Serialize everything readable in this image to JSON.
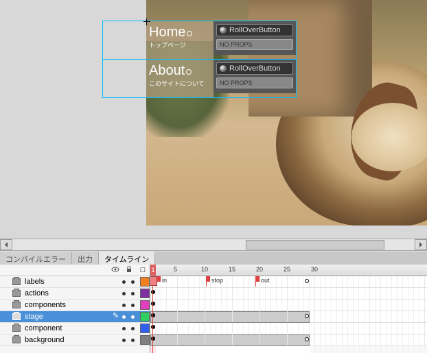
{
  "nav": {
    "items": [
      {
        "title": "Home",
        "sub": "トップページ",
        "component": "RollOverButton",
        "props": "NO PROPS"
      },
      {
        "title": "About",
        "sub": "このサイトについて",
        "component": "RollOverButton",
        "props": "NO PROPS"
      }
    ]
  },
  "tabs": {
    "compile_error": "コンパイルエラー",
    "output": "出力",
    "timeline": "タイムライン"
  },
  "ruler": {
    "marks": [
      "1",
      "5",
      "10",
      "15",
      "20",
      "25",
      "30"
    ]
  },
  "layers": [
    {
      "name": "labels",
      "color": "#f08020"
    },
    {
      "name": "actions",
      "color": "#8030a0"
    },
    {
      "name": "components",
      "color": "#e040c0"
    },
    {
      "name": "stage",
      "color": "#30d060",
      "selected": true
    },
    {
      "name": "component",
      "color": "#3060f0"
    },
    {
      "name": "background",
      "color": "#808080"
    }
  ],
  "frame_labels": {
    "in": "in",
    "stop": "stop",
    "out": "out"
  },
  "icons": {
    "eye": "●",
    "lock": "🔒",
    "outline": "□"
  }
}
